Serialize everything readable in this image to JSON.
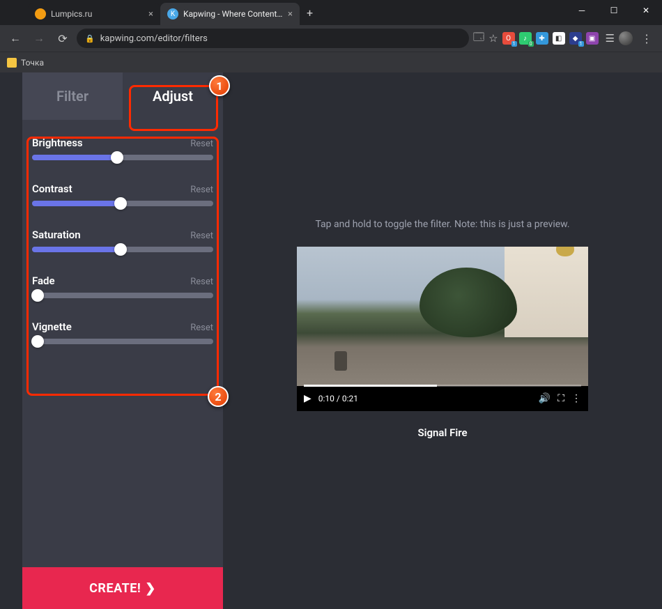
{
  "browser": {
    "tabs": [
      {
        "title": "Lumpics.ru",
        "active": false
      },
      {
        "title": "Kapwing - Where Content Creati",
        "active": true
      }
    ],
    "url": "kapwing.com/editor/filters",
    "bookmark": "Точка"
  },
  "sidebar": {
    "tab_filter": "Filter",
    "tab_adjust": "Adjust",
    "reset_label": "Reset",
    "controls": [
      {
        "label": "Brightness",
        "value": 47
      },
      {
        "label": "Contrast",
        "value": 49
      },
      {
        "label": "Saturation",
        "value": 49
      },
      {
        "label": "Fade",
        "value": 3
      },
      {
        "label": "Vignette",
        "value": 3
      }
    ],
    "create_label": "CREATE!"
  },
  "preview": {
    "hint": "Tap and hold to toggle the filter. Note: this is just a preview.",
    "video": {
      "current": "0:10",
      "duration": "0:21"
    },
    "title": "Signal Fire"
  },
  "annotations": {
    "a1": "1",
    "a2": "2"
  }
}
